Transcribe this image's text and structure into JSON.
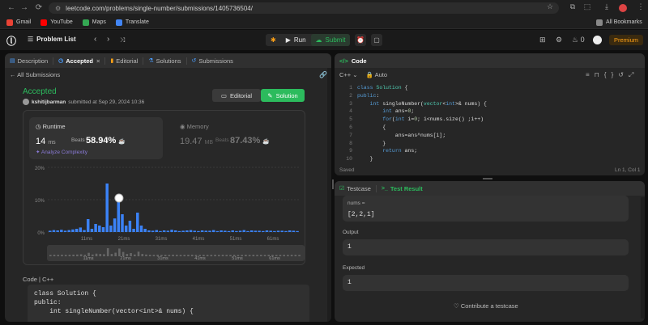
{
  "browser": {
    "url": "leetcode.com/problems/single-number/submissions/1405736504/",
    "bookmarks": [
      {
        "label": "Gmail",
        "color": "#ea4335"
      },
      {
        "label": "YouTube",
        "color": "#ff0000"
      },
      {
        "label": "Maps",
        "color": "#34a853"
      },
      {
        "label": "Translate",
        "color": "#4285f4"
      }
    ],
    "all_bookmarks": "All Bookmarks"
  },
  "header": {
    "problem_list": "Problem List",
    "run": "Run",
    "submit": "Submit",
    "streak": "0",
    "premium": "Premium"
  },
  "left": {
    "tabs": [
      {
        "label": "Description",
        "icon": "description-icon"
      },
      {
        "label": "Accepted",
        "icon": "clock-icon"
      },
      {
        "label": "Editorial",
        "icon": "book-icon"
      },
      {
        "label": "Solutions",
        "icon": "flask-icon"
      },
      {
        "label": "Submissions",
        "icon": "history-icon"
      }
    ],
    "all_submissions": "All Submissions",
    "status": "Accepted",
    "user": "kshitijbarman",
    "submitted_at": "submitted at Sep 29, 2024 10:36",
    "editorial_btn": "Editorial",
    "solution_btn": "Solution",
    "runtime": {
      "label": "Runtime",
      "value": "14",
      "unit": "ms",
      "beats_label": "Beats",
      "beats": "58.94%",
      "analyze": "Analyze Complexity"
    },
    "memory": {
      "label": "Memory",
      "value": "19.47",
      "unit": "MB",
      "beats_label": "Beats",
      "beats": "87.43%"
    },
    "code_label": "Code",
    "code_lang": "C++",
    "code_snippet": "class Solution {\npublic:\n    int singleNumber(vector<int>& nums) {"
  },
  "chart_data": {
    "type": "bar",
    "ylim": [
      0,
      20
    ],
    "yticks": [
      "20%",
      "10%",
      "0%"
    ],
    "xticks": [
      "11ms",
      "21ms",
      "31ms",
      "41ms",
      "51ms",
      "61ms"
    ],
    "values": [
      0.4,
      0.6,
      0.5,
      0.7,
      0.4,
      0.6,
      0.8,
      1.0,
      1.4,
      0.6,
      4.0,
      1.0,
      2.5,
      2.0,
      1.5,
      15.0,
      2.0,
      4.2,
      11.5,
      5.5,
      2.0,
      3.5,
      1.0,
      6.0,
      2.0,
      1.0,
      0.5,
      0.4,
      0.6,
      0.3,
      0.5,
      0.4,
      0.7,
      0.5,
      0.3,
      0.4,
      0.5,
      0.6,
      0.4,
      0.3,
      0.5,
      0.4,
      0.4,
      0.6,
      0.3,
      0.5,
      0.4,
      0.3,
      0.5,
      0.3,
      0.4,
      0.6,
      0.3,
      0.5,
      0.4,
      0.4,
      0.3,
      0.5,
      0.4,
      0.3,
      0.4,
      0.4,
      0.3,
      0.5,
      0.4,
      0.3
    ],
    "highlight_index": 18,
    "bar_color": "#3b82f6",
    "highlight_color": "#ffffff"
  },
  "editor": {
    "title": "Code",
    "lang": "C++",
    "mode": "Auto",
    "line_numbers": [
      "1",
      "2",
      "3",
      "4",
      "5",
      "6",
      "7",
      "8",
      "9",
      "10"
    ],
    "status": "Saved",
    "position": "Ln 1, Col 1"
  },
  "testpanel": {
    "tabs": [
      "Testcase",
      "Test Result"
    ],
    "input_label": "nums =",
    "input_value": "[2,2,1]",
    "output_label": "Output",
    "output_value": "1",
    "expected_label": "Expected",
    "expected_value": "1",
    "contribute": "Contribute a testcase"
  }
}
